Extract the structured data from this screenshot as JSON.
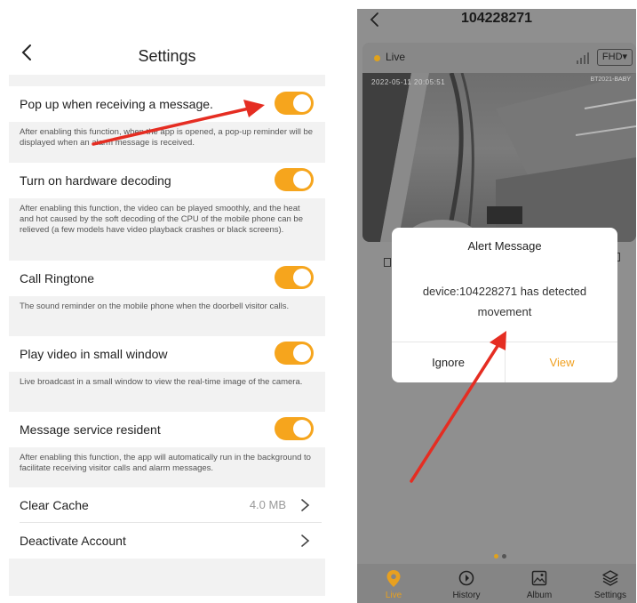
{
  "settings": {
    "title": "Settings",
    "toggles": [
      {
        "label": "Pop up when receiving a message.",
        "desc": "After enabling this function, when the app is opened, a pop-up reminder will be displayed when an alarm message is received.",
        "on": true
      },
      {
        "label": "Turn on hardware decoding",
        "desc": "After enabling this function, the video can be played smoothly, and the heat and hot caused by the soft decoding of the CPU of the mobile phone can be relieved (a few models have video playback crashes or black screens).",
        "on": true
      },
      {
        "label": "Call Ringtone",
        "desc": "The sound reminder on the mobile phone when the doorbell visitor calls.",
        "on": true
      },
      {
        "label": "Play video in small window",
        "desc": "Live broadcast in a small window to view the real-time image of the camera.",
        "on": true
      },
      {
        "label": "Message service resident",
        "desc": "After enabling this function, the app will automatically run in the background to facilitate receiving visitor calls and alarm messages.",
        "on": true
      }
    ],
    "clear_cache": {
      "label": "Clear Cache",
      "value": "4.0 MB"
    },
    "deactivate": {
      "label": "Deactivate Account"
    },
    "accent": "#f6a51d"
  },
  "live": {
    "device_title": "104228271",
    "live_label": "Live",
    "quality": "FHD▾",
    "overlay_timestamp": "2022-05-11 20:05:51",
    "overlay_corner": "BT2021-BABY",
    "dialog": {
      "title": "Alert Message",
      "message": "device:104228271 has detected movement",
      "ignore": "Ignore",
      "view": "View"
    },
    "tabs": [
      {
        "label": "Live",
        "icon": "location-pin-icon",
        "active": true
      },
      {
        "label": "History",
        "icon": "history-icon",
        "active": false
      },
      {
        "label": "Album",
        "icon": "album-icon",
        "active": false
      },
      {
        "label": "Settings",
        "icon": "layers-icon",
        "active": false
      }
    ],
    "accent": "#f0a020"
  }
}
